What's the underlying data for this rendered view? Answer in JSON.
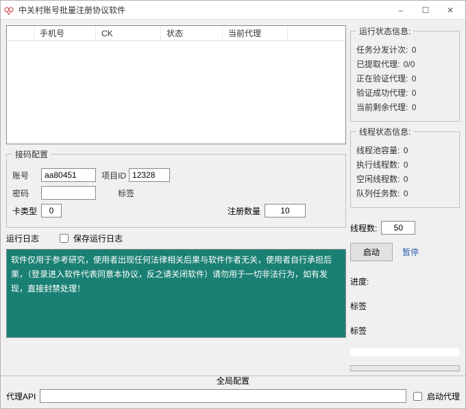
{
  "window": {
    "title": "中关村账号批量注册协议软件",
    "min": "–",
    "max": "☐",
    "close": "✕"
  },
  "table": {
    "columns": [
      "手机号",
      "CK",
      "状态",
      "当前代理"
    ]
  },
  "runStatus": {
    "legend": "运行状态信息:",
    "k1": "任务分发计次:",
    "v1": "0",
    "k2": "已提取代理:",
    "v2": "0/0",
    "k3": "正在验证代理:",
    "v3": "0",
    "k4": "验证成功代理:",
    "v4": "0",
    "k5": "当前剩余代理:",
    "v5": "0"
  },
  "threadStatus": {
    "legend": "线程状态信息:",
    "k1": "线程池容量:",
    "v1": "0",
    "k2": "执行线程数:",
    "v2": "0",
    "k3": "空闲线程数:",
    "v3": "0",
    "k4": "队列任务数:",
    "v4": "0"
  },
  "sms": {
    "legend": "接码配置",
    "account_lbl": "账号",
    "account_val": "aa80451",
    "projid_lbl": "项目ID",
    "projid_val": "12328",
    "pwd_lbl": "密码",
    "pwd_val": "",
    "tag_lbl": "标签",
    "tag_val": "",
    "cardtype_lbl": "卡类型",
    "cardtype_val": "0"
  },
  "reg": {
    "count_lbl": "注册数量",
    "count_val": "10"
  },
  "log": {
    "lbl": "运行日志",
    "save_lbl": "保存运行日志",
    "text": "软件仅用于参考研究，使用者出现任何法律相关后果与软件作者无关，使用者自行承担后果，（登录进入软件代表同意本协议，反之请关闭软件）请勿用于一切非法行为，如有发现，直接封禁处理！"
  },
  "control": {
    "threads_lbl": "线程数:",
    "threads_val": "50",
    "start": "启动",
    "pause": "暂停",
    "progress_lbl": "进度:",
    "tag1": "标签",
    "tag2": "标签"
  },
  "globalcfg": {
    "legend": "全局配置",
    "api_lbl": "代理API",
    "api_val": "",
    "enable_proxy_lbl": "启动代理"
  }
}
